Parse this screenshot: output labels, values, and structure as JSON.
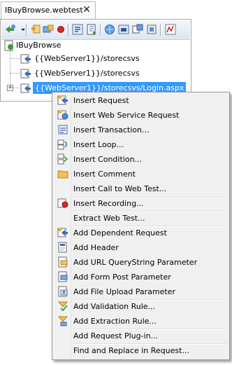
{
  "tab": {
    "title": "IBuyBrowse.webtest",
    "close_glyph": "✕"
  },
  "toolbar": {
    "buttons": [
      "add-request-icon",
      "dropdown-arrow-icon",
      "credentials-icon",
      "parameterize-icon",
      "record-icon",
      "insert-transaction-icon",
      "generate-code-icon",
      "web-server-icon",
      "context-params-icon",
      "extract-icon",
      "set-plugin-icon",
      "perf-session-icon"
    ]
  },
  "tree": {
    "root": {
      "label": "IBuyBrowse",
      "icon": "webtest-icon"
    },
    "items": [
      {
        "label": "{{WebServer1}}/storecsvs",
        "icon": "request-icon"
      },
      {
        "label": "{{WebServer1}}/storecsvs",
        "icon": "request-icon"
      },
      {
        "label": "{{WebServer1}}/storecsvs/Login.aspx",
        "icon": "request-icon",
        "expander": "+"
      }
    ]
  },
  "context_menu": {
    "items": [
      {
        "label": "Insert Request",
        "icon": "insert-request-icon"
      },
      {
        "label": "Insert Web Service Request",
        "icon": "insert-web-service-icon"
      },
      {
        "label": "Insert Transaction...",
        "icon": "insert-transaction-icon"
      },
      {
        "label": "Insert Loop...",
        "icon": "insert-loop-icon"
      },
      {
        "label": "Insert Condition...",
        "icon": "insert-condition-icon"
      },
      {
        "label": "Insert Comment",
        "icon": "folder-icon"
      },
      {
        "label": "Insert Call to Web Test...",
        "icon": ""
      },
      {
        "label": "Insert Recording...",
        "icon": "insert-recording-icon"
      },
      {
        "label": "Extract Web Test...",
        "icon": ""
      },
      {
        "label": "Add Dependent Request",
        "icon": "dependent-request-icon"
      },
      {
        "label": "Add Header",
        "icon": "header-icon"
      },
      {
        "label": "Add URL QueryString Parameter",
        "icon": "querystring-icon"
      },
      {
        "label": "Add Form Post Parameter",
        "icon": "form-post-icon"
      },
      {
        "label": "Add File Upload Parameter",
        "icon": "file-upload-icon"
      },
      {
        "label": "Add Validation Rule...",
        "icon": "validation-rule-icon"
      },
      {
        "label": "Add Extraction Rule...",
        "icon": "extraction-rule-icon"
      },
      {
        "label": "Add Request Plug-in...",
        "icon": ""
      },
      {
        "label": "Find and Replace in Request...",
        "icon": ""
      }
    ]
  },
  "colors": {
    "selection": "#3399ff",
    "menu_bg": "#f0f0f0",
    "toolbar_top": "#f3f6fb",
    "toolbar_bottom": "#dde6f2"
  }
}
